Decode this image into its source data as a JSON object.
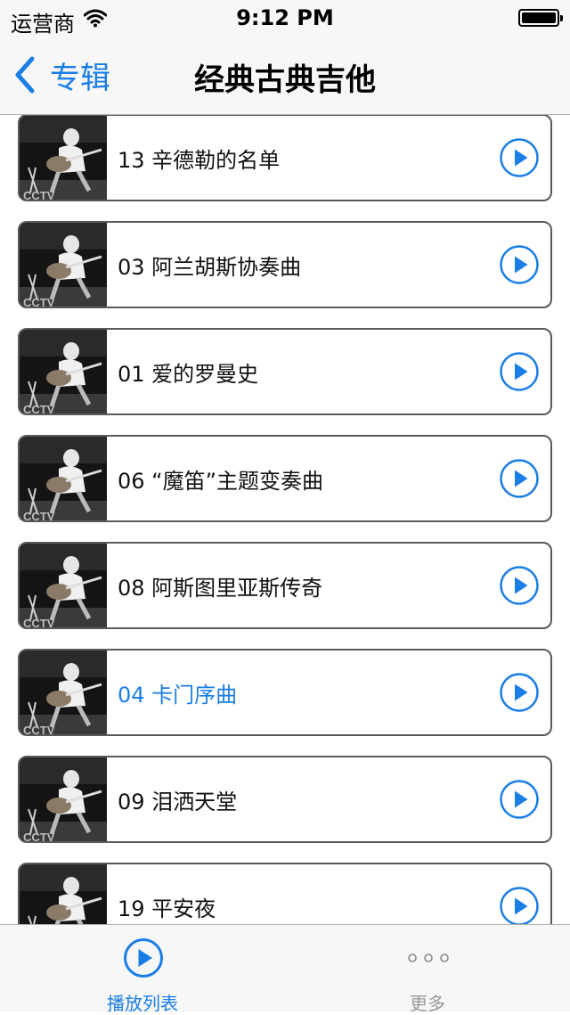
{
  "status_bar": {
    "carrier": "运营商",
    "time": "9:12 PM"
  },
  "nav": {
    "back_label": "专辑",
    "title": "经典古典吉他"
  },
  "tracks": [
    {
      "title": "13  辛德勒的名单",
      "active": false
    },
    {
      "title": "03 阿兰胡斯协奏曲",
      "active": false
    },
    {
      "title": "01 爱的罗曼史",
      "active": false
    },
    {
      "title": "06 “魔笛”主题变奏曲",
      "active": false
    },
    {
      "title": "08 阿斯图里亚斯传奇",
      "active": false
    },
    {
      "title": "04 卡门序曲",
      "active": true
    },
    {
      "title": "09 泪洒天堂",
      "active": false
    },
    {
      "title": "19 平安夜",
      "active": false
    }
  ],
  "tab_bar": {
    "tabs": [
      {
        "label": "播放列表",
        "icon": "play-circle-icon",
        "selected": true
      },
      {
        "label": "更多",
        "icon": "more-dots-icon",
        "selected": false
      }
    ]
  },
  "colors": {
    "accent": "#1a7ee6",
    "bar_background": "#f7f7f7",
    "row_border": "#5a5a5a"
  }
}
